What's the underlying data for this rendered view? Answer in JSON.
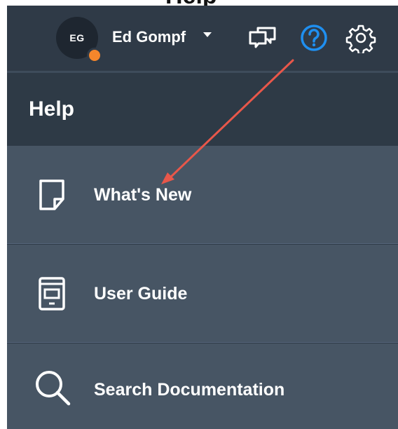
{
  "header": {
    "clipped_title": "Help",
    "user": {
      "initials": "EG",
      "name": "Ed Gompf",
      "status_color": "#f5862b"
    }
  },
  "icons": {
    "chat": "chat-bubbles-icon",
    "help": "help-question-icon",
    "settings": "gear-icon"
  },
  "help_menu": {
    "title": "Help",
    "items": [
      {
        "label": "What's New",
        "icon": "document-page-icon"
      },
      {
        "label": "User Guide",
        "icon": "guide-book-icon"
      },
      {
        "label": "Search Documentation",
        "icon": "search-icon"
      }
    ]
  },
  "annotation": {
    "arrow_color": "#e8574a"
  },
  "colors": {
    "help_accent": "#1f8ff0",
    "header_bg": "#2e3a46",
    "menu_bg": "#475564"
  }
}
